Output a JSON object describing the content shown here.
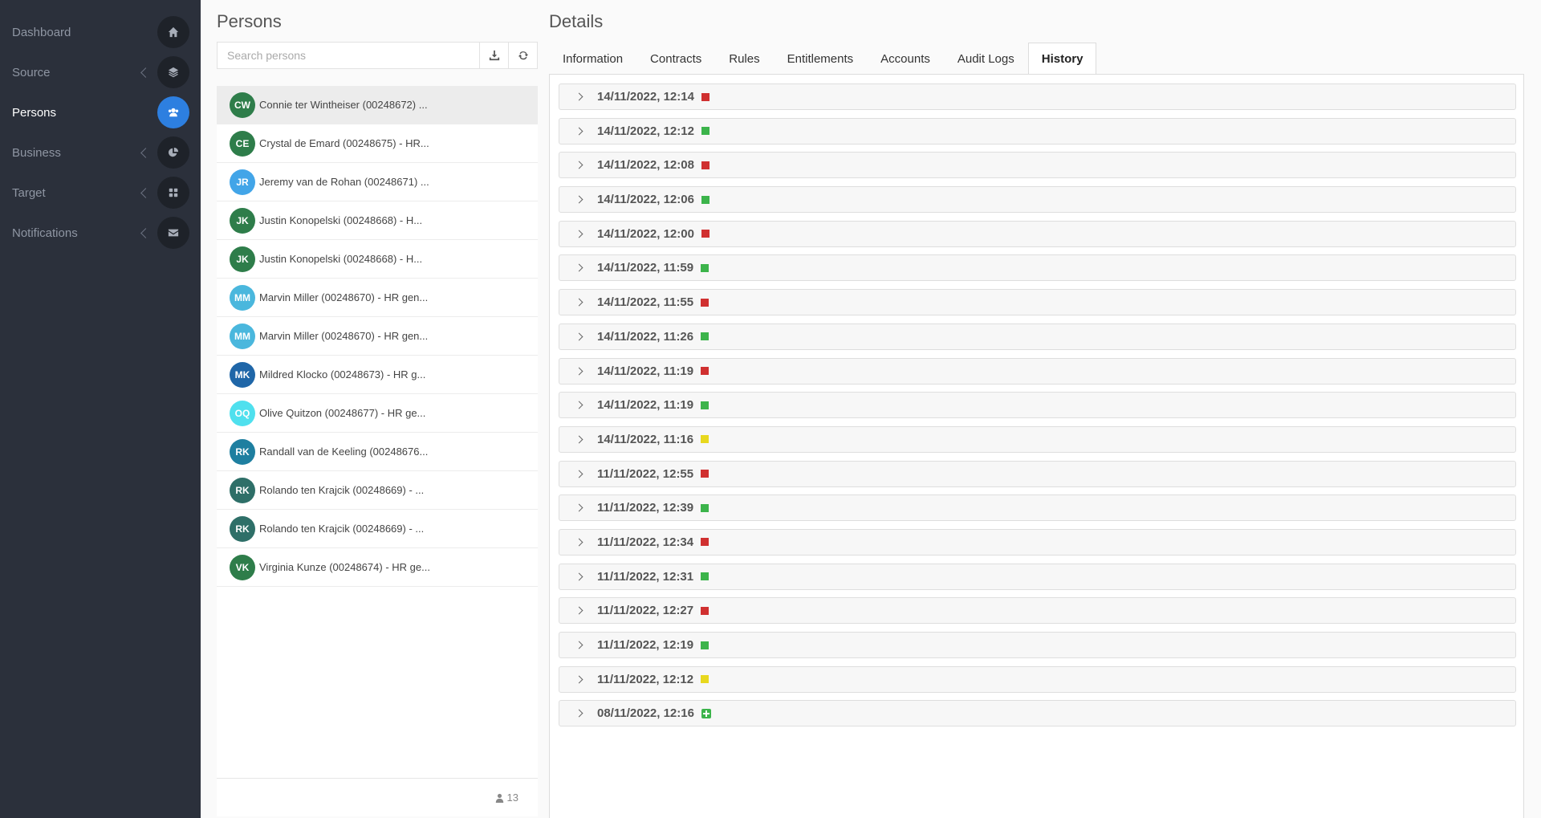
{
  "colors": {
    "sidebar_bg": "#2b303b",
    "accent": "#2d7fe0",
    "status_red": "#d03030",
    "status_green": "#3cb44b",
    "status_yellow": "#e8d81e"
  },
  "sidebar": {
    "items": [
      {
        "label": "Dashboard",
        "icon": "home-icon",
        "chevron": false,
        "active": false
      },
      {
        "label": "Source",
        "icon": "layers-icon",
        "chevron": true,
        "active": false
      },
      {
        "label": "Persons",
        "icon": "users-icon",
        "chevron": false,
        "active": true
      },
      {
        "label": "Business",
        "icon": "pie-chart-icon",
        "chevron": true,
        "active": false
      },
      {
        "label": "Target",
        "icon": "grid-icon",
        "chevron": true,
        "active": false
      },
      {
        "label": "Notifications",
        "icon": "envelope-icon",
        "chevron": true,
        "active": false
      }
    ]
  },
  "persons": {
    "title": "Persons",
    "search_placeholder": "Search persons",
    "count": "13",
    "list": [
      {
        "initials": "CW",
        "name": "Connie ter Wintheiser (00248672) ...",
        "color": "#2e7d4a",
        "selected": true
      },
      {
        "initials": "CE",
        "name": "Crystal de Emard (00248675) - HR...",
        "color": "#2e7d4a",
        "selected": false
      },
      {
        "initials": "JR",
        "name": "Jeremy van de Rohan (00248671) ...",
        "color": "#42a5e8",
        "selected": false
      },
      {
        "initials": "JK",
        "name": "Justin Konopelski (00248668) - H...",
        "color": "#2e7d4a",
        "selected": false
      },
      {
        "initials": "JK",
        "name": "Justin Konopelski (00248668) - H...",
        "color": "#2e7d4a",
        "selected": false
      },
      {
        "initials": "MM",
        "name": "Marvin Miller (00248670) - HR gen...",
        "color": "#4ab7dd",
        "selected": false
      },
      {
        "initials": "MM",
        "name": "Marvin Miller (00248670) - HR gen...",
        "color": "#4ab7dd",
        "selected": false
      },
      {
        "initials": "MK",
        "name": "Mildred Klocko (00248673) - HR g...",
        "color": "#1f66a8",
        "selected": false
      },
      {
        "initials": "OQ",
        "name": "Olive Quitzon (00248677) - HR ge...",
        "color": "#4fe0ee",
        "selected": false
      },
      {
        "initials": "RK",
        "name": "Randall van de Keeling (00248676...",
        "color": "#1e7fa0",
        "selected": false
      },
      {
        "initials": "RK",
        "name": "Rolando ten Krajcik (00248669) - ...",
        "color": "#2e6f68",
        "selected": false
      },
      {
        "initials": "RK",
        "name": "Rolando ten Krajcik (00248669) - ...",
        "color": "#2e6f68",
        "selected": false
      },
      {
        "initials": "VK",
        "name": "Virginia Kunze (00248674) - HR ge...",
        "color": "#2e7d4a",
        "selected": false
      }
    ]
  },
  "details": {
    "title": "Details",
    "tabs": [
      {
        "label": "Information",
        "active": false
      },
      {
        "label": "Contracts",
        "active": false
      },
      {
        "label": "Rules",
        "active": false
      },
      {
        "label": "Entitlements",
        "active": false
      },
      {
        "label": "Accounts",
        "active": false
      },
      {
        "label": "Audit Logs",
        "active": false
      },
      {
        "label": "History",
        "active": true
      }
    ],
    "history": [
      {
        "date": "14/11/2022, 12:14",
        "status": "red"
      },
      {
        "date": "14/11/2022, 12:12",
        "status": "green"
      },
      {
        "date": "14/11/2022, 12:08",
        "status": "red"
      },
      {
        "date": "14/11/2022, 12:06",
        "status": "green"
      },
      {
        "date": "14/11/2022, 12:00",
        "status": "red"
      },
      {
        "date": "14/11/2022, 11:59",
        "status": "green"
      },
      {
        "date": "14/11/2022, 11:55",
        "status": "red"
      },
      {
        "date": "14/11/2022, 11:26",
        "status": "green"
      },
      {
        "date": "14/11/2022, 11:19",
        "status": "red"
      },
      {
        "date": "14/11/2022, 11:19",
        "status": "green"
      },
      {
        "date": "14/11/2022, 11:16",
        "status": "yellow"
      },
      {
        "date": "11/11/2022, 12:55",
        "status": "red"
      },
      {
        "date": "11/11/2022, 12:39",
        "status": "green"
      },
      {
        "date": "11/11/2022, 12:34",
        "status": "red"
      },
      {
        "date": "11/11/2022, 12:31",
        "status": "green"
      },
      {
        "date": "11/11/2022, 12:27",
        "status": "red"
      },
      {
        "date": "11/11/2022, 12:19",
        "status": "green"
      },
      {
        "date": "11/11/2022, 12:12",
        "status": "yellow"
      },
      {
        "date": "08/11/2022, 12:16",
        "status": "plus"
      }
    ]
  }
}
